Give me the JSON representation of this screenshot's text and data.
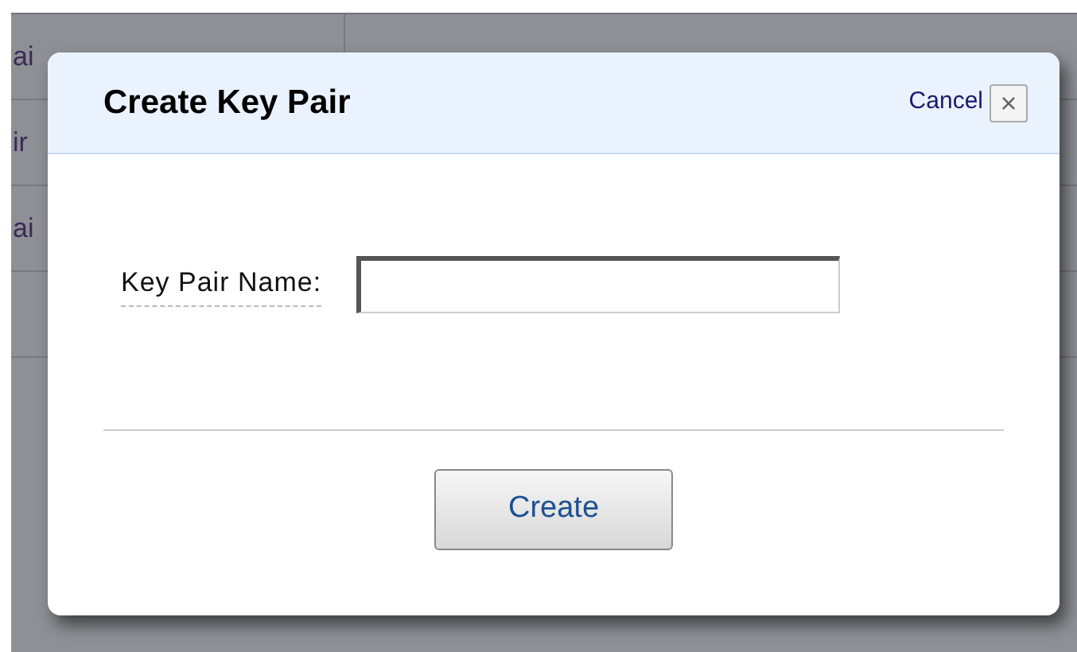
{
  "background_table": {
    "rows": [
      {
        "column_1": "ai"
      },
      {
        "column_1": "ir"
      },
      {
        "column_1": "ai"
      },
      {}
    ]
  },
  "dialog": {
    "title": "Create Key Pair",
    "cancel_link": "Cancel",
    "close_button": "×",
    "field": {
      "label": "Key Pair Name:"
    },
    "buttons": [
      {
        "label": "Create"
      }
    ]
  }
}
